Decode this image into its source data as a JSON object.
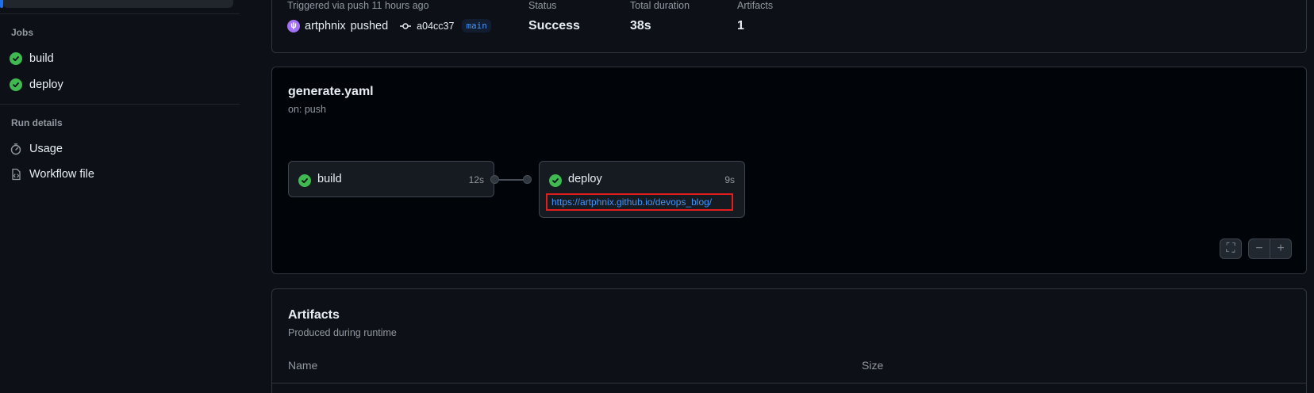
{
  "sidebar": {
    "jobs_heading": "Jobs",
    "jobs": [
      {
        "label": "build",
        "status": "success"
      },
      {
        "label": "deploy",
        "status": "success"
      }
    ],
    "run_details_heading": "Run details",
    "run_details": [
      {
        "label": "Usage",
        "icon": "stopwatch-icon"
      },
      {
        "label": "Workflow file",
        "icon": "file-code-icon"
      }
    ]
  },
  "summary": {
    "trigger_label": "Triggered via push 11 hours ago",
    "actor": "artphnix",
    "action": "pushed",
    "commit": "a04cc37",
    "branch": "main",
    "status_label": "Status",
    "status_value": "Success",
    "duration_label": "Total duration",
    "duration_value": "38s",
    "artifacts_label": "Artifacts",
    "artifacts_value": "1"
  },
  "workflow": {
    "file": "generate.yaml",
    "trigger": "on: push",
    "jobs": [
      {
        "name": "build",
        "duration": "12s"
      },
      {
        "name": "deploy",
        "duration": "9s",
        "link": "https://artphnix.github.io/devops_blog/"
      }
    ],
    "controls": {
      "fullscreen": "⛶",
      "zoom_out": "−",
      "zoom_in": "+"
    }
  },
  "artifacts": {
    "title": "Artifacts",
    "subtitle": "Produced during runtime",
    "columns": [
      "Name",
      "Size"
    ]
  },
  "colors": {
    "success": "#3fb950",
    "link": "#4493f8",
    "highlight": "#e11d1d"
  }
}
